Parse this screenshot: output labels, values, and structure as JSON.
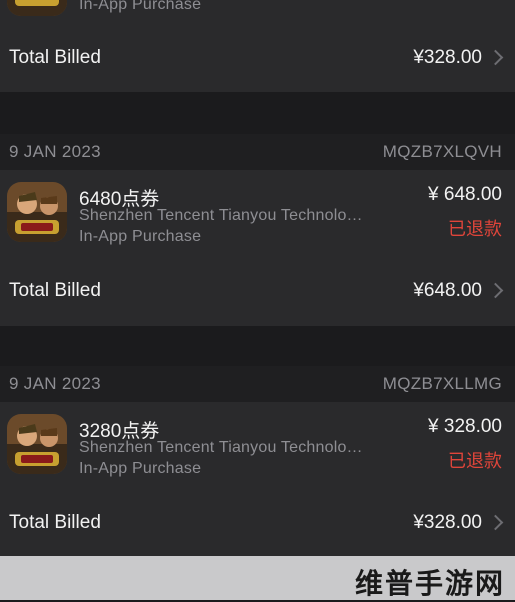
{
  "top_item": {
    "purchase_type": "In-App Purchase",
    "total_label": "Total Billed",
    "total": "¥328.00"
  },
  "receipts": [
    {
      "date": "9 JAN 2023",
      "order_id": "MQZB7XLQVH",
      "product": "6480点券",
      "seller": "Shenzhen Tencent Tianyou Technology Ltd",
      "purchase_type": "In-App Purchase",
      "price": "¥ 648.00",
      "status": "已退款",
      "total_label": "Total Billed",
      "total": "¥648.00"
    },
    {
      "date": "9 JAN 2023",
      "order_id": "MQZB7XLLMG",
      "product": "3280点券",
      "seller": "Shenzhen Tencent Tianyou Technology Ltd",
      "purchase_type": "In-App Purchase",
      "price": "¥ 328.00",
      "status": "已退款",
      "total_label": "Total Billed",
      "total": "¥328.00"
    }
  ],
  "watermark": "维普手游网",
  "colors": {
    "background": "#1b1b1d",
    "card": "#2a2a2c",
    "secondary_text": "#8e8e93",
    "refund_red": "#e0453a"
  },
  "icons": {
    "app_icon": "game-app-icon",
    "chevron": "chevron-right-icon"
  }
}
